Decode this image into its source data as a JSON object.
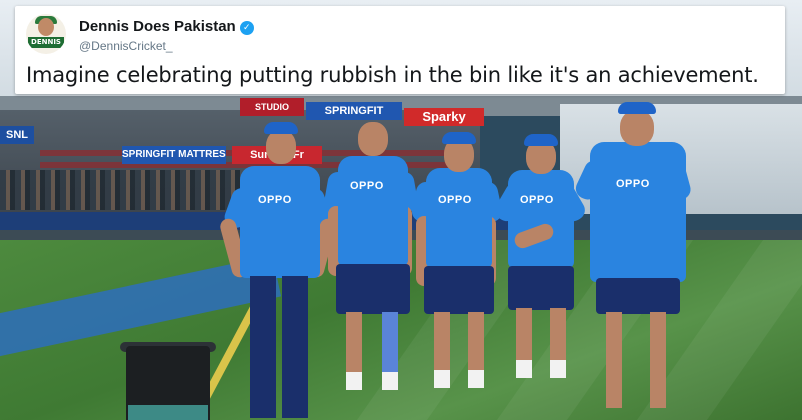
{
  "tweet": {
    "display_name": "Dennis Does Pakistan",
    "handle": "@DennisCricket_",
    "text": "Imagine celebrating putting rubbish in the bin like it's an achievement.",
    "avatar_label": "DENNIS",
    "verified_icon": "verified-badge-icon",
    "colors": {
      "verified": "#1da1f2",
      "name": "#14171a",
      "handle": "#657786"
    }
  },
  "photo": {
    "hoardings": [
      {
        "text": "SNL",
        "color": "#1d4fa0"
      },
      {
        "text": "SPRINGFIT MATTRESS",
        "color": "#2057b0"
      },
      {
        "text": "Sunday Fr",
        "color": "#c8272f"
      },
      {
        "text": "SPRINGFIT",
        "color": "#2057b0"
      },
      {
        "text": "Sparky",
        "color": "#d12a2a"
      },
      {
        "text": "STUDIO",
        "color": "#b11e2a"
      }
    ],
    "jersey_text": "OPPO",
    "kit_colors": {
      "shirt": "#2a84e0",
      "cap": "#1f64c8",
      "shorts": "#1a2f6b"
    }
  }
}
